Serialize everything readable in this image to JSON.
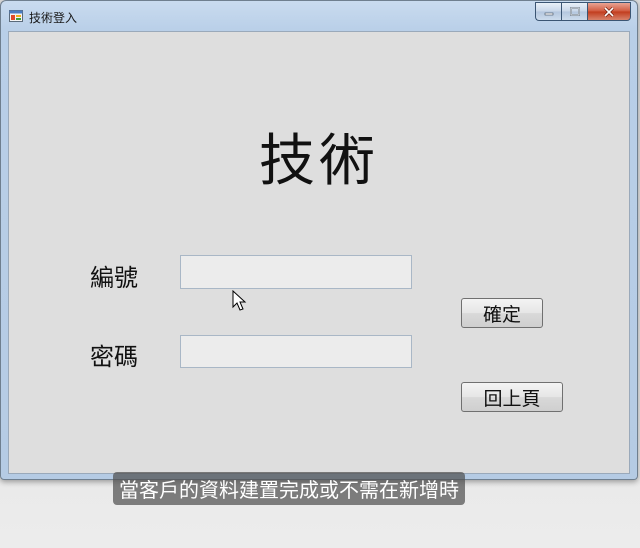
{
  "window": {
    "title": "技術登入",
    "app_icon": "windows-form-icon",
    "caption_buttons": [
      "minimize-icon",
      "maximize-icon",
      "close-icon"
    ]
  },
  "form": {
    "heading": "技術",
    "id_label": "編號",
    "id_value": "",
    "password_label": "密碼",
    "password_value": "",
    "confirm_label": "確定",
    "back_label": "回上頁"
  },
  "overlay": {
    "subtitle": "當客戶的資料建置完成或不需在新增時"
  },
  "colors": {
    "client_bg": "#dedede",
    "titlebar": "#c9dbef",
    "close_button": "#c13b1c"
  }
}
